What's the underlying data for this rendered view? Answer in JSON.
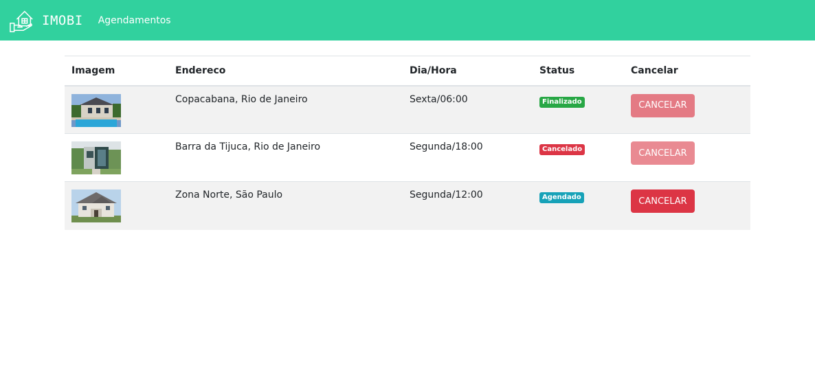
{
  "navbar": {
    "brand": "IMOBI",
    "link": "Agendamentos",
    "logo_icon": "house-hand-icon",
    "bg_color": "#31d19e"
  },
  "table": {
    "headers": [
      "Imagem",
      "Endereco",
      "Dia/Hora",
      "Status",
      "Cancelar"
    ],
    "rows": [
      {
        "image_icon": "house-pool-photo",
        "address": "Copacabana, Rio de Janeiro",
        "day_time": "Sexta/06:00",
        "status": "Finalizado",
        "status_color": "#28a745",
        "cancel_label": "CANCELAR",
        "cancel_color": "#e47a84",
        "cancel_disabled": true
      },
      {
        "image_icon": "modern-house-photo",
        "address": "Barra da Tijuca, Rio de Janeiro",
        "day_time": "Segunda/18:00",
        "status": "Cancelado",
        "status_color": "#dc3545",
        "cancel_label": "CANCELAR",
        "cancel_color": "#e98a92",
        "cancel_disabled": true
      },
      {
        "image_icon": "suburban-house-photo",
        "address": "Zona Norte, São Paulo",
        "day_time": "Segunda/12:00",
        "status": "Agendado",
        "status_color": "#17a2b8",
        "cancel_label": "CANCELAR",
        "cancel_color": "#dc3545",
        "cancel_disabled": false
      }
    ]
  }
}
